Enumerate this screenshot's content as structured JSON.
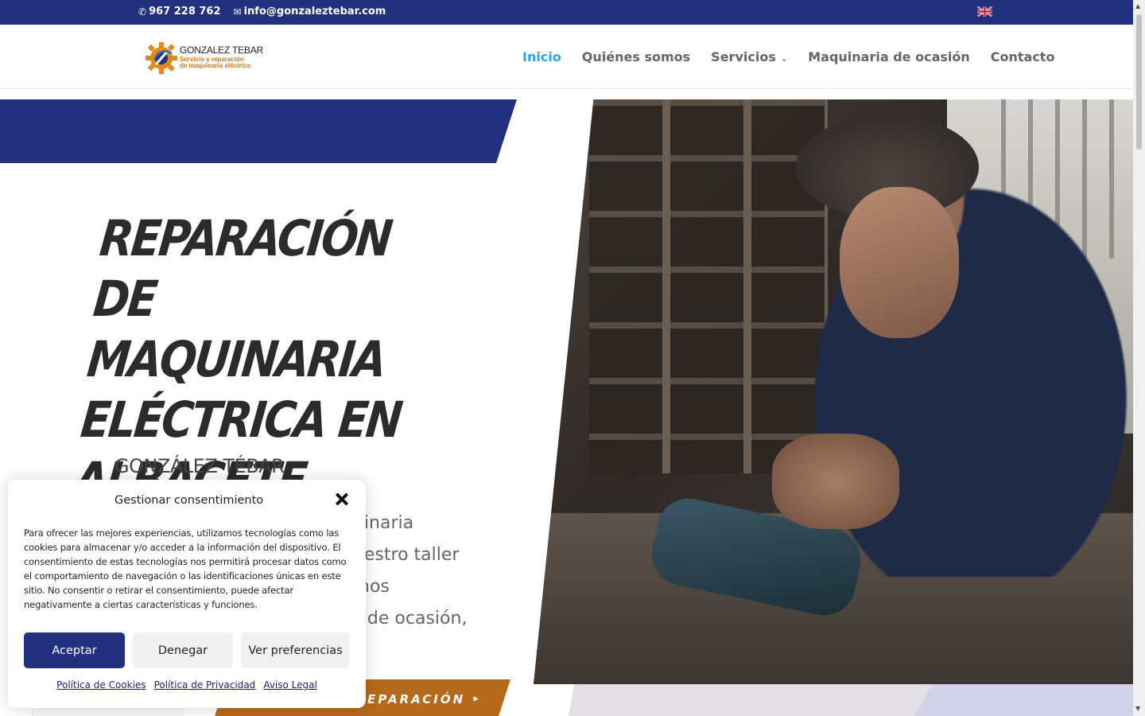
{
  "topbar": {
    "phone": "967 228 762",
    "email": "info@gonzaleztebar.com",
    "language_flag": "uk-flag-icon"
  },
  "header": {
    "logo_brand": "GONZALEZ TEBAR",
    "logo_tagline_1": "Servicio y reparación",
    "logo_tagline_2": "de maquinaria eléctrica",
    "nav": [
      {
        "label": "Inicio",
        "active": true
      },
      {
        "label": "Quiénes somos",
        "active": false
      },
      {
        "label": "Servicios",
        "active": false,
        "has_dropdown": true
      },
      {
        "label": "Maquinaria de ocasión",
        "active": false
      },
      {
        "label": "Contacto",
        "active": false
      }
    ]
  },
  "hero": {
    "title_lines": [
      "REPARACIÓN DE",
      "MAQUINARIA",
      "ELÉCTRICA EN",
      "ALBACETE"
    ],
    "subtitle": "GONZÁLEZ TÉBAR",
    "desc_lines": [
      "quinaria",
      "nuestro taller",
      "emos",
      "as de ocasión,"
    ],
    "cta_label": "REPARACIÓN ‣"
  },
  "cookie": {
    "title": "Gestionar consentimiento",
    "text": "Para ofrecer las mejores experiencias, utilizamos tecnologías como las cookies para almacenar y/o acceder a la información del dispositivo. El consentimiento de estas tecnologías nos permitirá procesar datos como el comportamiento de navegación o las identificaciones únicas en este sitio. No consentir o retirar el consentimiento, puede afectar negativamente a ciertas características y funciones.",
    "accept": "Aceptar",
    "deny": "Denegar",
    "preferences": "Ver preferencias",
    "links": [
      "Política de Cookies",
      "Política de Privacidad",
      "Aviso Legal"
    ]
  },
  "colors": {
    "brand_blue": "#22307e",
    "accent_orange": "#b5691a",
    "nav_active": "#2ea3f2"
  }
}
